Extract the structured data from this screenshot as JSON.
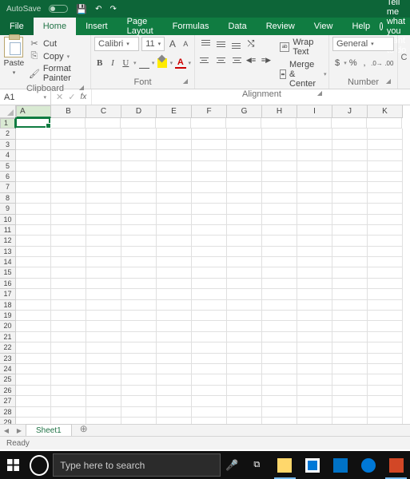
{
  "titlebar": {
    "autosave": "AutoSave"
  },
  "tabs": {
    "file": "File",
    "home": "Home",
    "insert": "Insert",
    "pagelayout": "Page Layout",
    "formulas": "Formulas",
    "data": "Data",
    "review": "Review",
    "view": "View",
    "help": "Help",
    "tellme": "Tell me what you want to do"
  },
  "ribbon": {
    "clipboard": {
      "label": "Clipboard",
      "paste": "Paste",
      "cut": "Cut",
      "copy": "Copy",
      "fmt": "Format Painter"
    },
    "font": {
      "label": "Font",
      "name": "Calibri",
      "size": "11",
      "bold": "B",
      "italic": "I",
      "ul": "U",
      "incA": "A",
      "decA": "A",
      "colorA": "A"
    },
    "align": {
      "label": "Alignment",
      "wrap": "Wrap Text",
      "merge": "Merge & Center"
    },
    "number": {
      "label": "Number",
      "format": "General",
      "currency": "$",
      "percent": "%",
      "comma": ","
    }
  },
  "fbar": {
    "namebox": "A1",
    "fx": "fx",
    "x": "✕",
    "chk": "✓"
  },
  "grid": {
    "cols": [
      "A",
      "B",
      "C",
      "D",
      "E",
      "F",
      "G",
      "H",
      "I",
      "J",
      "K"
    ],
    "rows": 29,
    "active": "A1"
  },
  "sheet": {
    "name": "Sheet1",
    "status": "Ready",
    "new": "⊕"
  },
  "taskbar": {
    "search": "Type here to search"
  }
}
